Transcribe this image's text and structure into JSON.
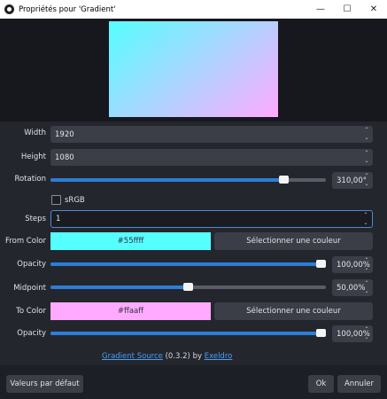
{
  "window": {
    "title": "Propriétés pour 'Gradient'",
    "minimize": "—",
    "maximize": "☐",
    "close": "✕"
  },
  "colors": {
    "from": "#55ffff",
    "to": "#ffaaff",
    "accent": "#2b7fd6"
  },
  "fields": {
    "width_label": "Width",
    "width_value": "1920",
    "height_label": "Height",
    "height_value": "1080",
    "rotation_label": "Rotation",
    "rotation_value": "310,00°",
    "rotation_level": 0.861,
    "srgb_label": "sRGB",
    "srgb_checked": false,
    "steps_label": "Steps",
    "steps_value": "1",
    "from_label": "From Color",
    "from_value": "#55ffff",
    "from_button": "Sélectionner une couleur",
    "opacity1_label": "Opacity",
    "opacity1_value": "100,00%",
    "opacity1_level": 1.0,
    "midpoint_label": "Midpoint",
    "midpoint_value": "50,00%",
    "midpoint_level": 0.5,
    "to_label": "To Color",
    "to_value": "#ffaaff",
    "to_button": "Sélectionner une couleur",
    "opacity2_label": "Opacity",
    "opacity2_value": "100,00%",
    "opacity2_level": 1.0
  },
  "footer": {
    "source_link": "Gradient Source",
    "version": " (0.3.2) by ",
    "author_link": "Exeldro"
  },
  "buttons": {
    "defaults": "Valeurs par défaut",
    "ok": "Ok",
    "cancel": "Annuler"
  }
}
